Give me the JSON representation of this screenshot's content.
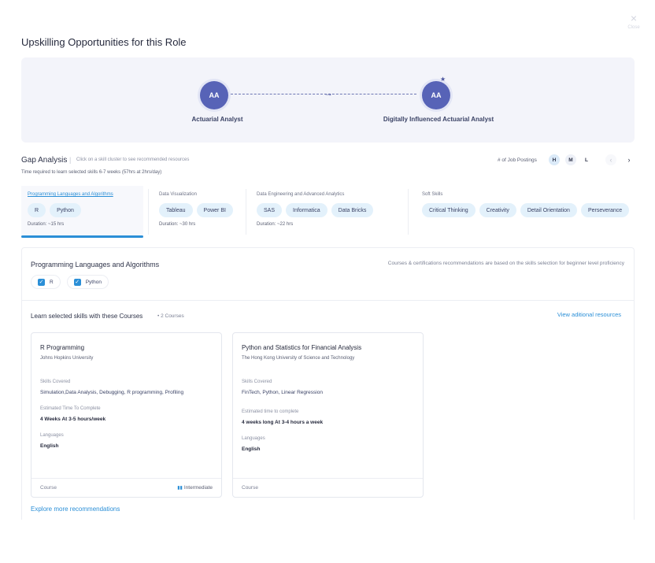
{
  "modal": {
    "title": "Upskilling Opportunities for this Role",
    "close_label": "Close"
  },
  "roles": {
    "from": {
      "initials": "AA",
      "name": "Actuarial Analyst"
    },
    "to": {
      "initials": "AA",
      "name": "Digitally Influenced Actuarial Analyst"
    }
  },
  "gap_analysis": {
    "title": "Gap Analysis",
    "separator": "|",
    "hint": "Click on a skill cluster to see recommended resources",
    "time_required": "Time required to learn selected skills 6-7 weeks (57hrs at 2hrs/day)",
    "job_postings_label": "# of Job Postings",
    "levels": [
      "H",
      "M",
      "L"
    ],
    "prev_icon": "‹",
    "next_icon": "›"
  },
  "clusters": [
    {
      "title": "Programming Languages and Algorithms",
      "skills": [
        "R",
        "Python"
      ],
      "duration": "Duration: ~15 hrs"
    },
    {
      "title": "Data Visualization",
      "skills": [
        "Tableau",
        "Power BI"
      ],
      "duration": "Duration: ~30 hrs"
    },
    {
      "title": "Data Engineering and Advanced Analytics",
      "skills": [
        "SAS",
        "Informatica",
        "Data Bricks"
      ],
      "duration": "Duration: ~22 hrs"
    },
    {
      "title": "Soft Skills",
      "skills": [
        "Critical Thinking",
        "Creativity",
        "Detail Orientation",
        "Perseverance"
      ],
      "duration": ""
    }
  ],
  "details": {
    "title": "Programming Languages and Algorithms",
    "note": "Courses & certifications recommendations are based on the skills selection for beginner level proficiency",
    "checkboxes": [
      "R",
      "Python"
    ],
    "check_glyph": "✓",
    "learn_title": "Learn selected skills with these Courses",
    "course_count": "• 2 Courses",
    "view_link": "View aditional resources",
    "explore_link": "Explore more recommendations"
  },
  "courses": [
    {
      "name": "R Programming",
      "provider": "Johns Hopkins University",
      "skills_label": "Skills Covered",
      "skills": "Simulation,Data Analysis, Debugging, R programming, Profiling",
      "time_label": "Estimated Time To Complete",
      "time": "4 Weeks At 3-5 hours/week",
      "lang_label": "Languages",
      "lang": "English",
      "type": "Course",
      "level": "Intermediate"
    },
    {
      "name": "Python and Statistics for Financial Analysis",
      "provider": "The Hong Kong University of Science and Technology",
      "skills_label": "Skills Covered",
      "skills": "FinTech, Python, Linear Regression",
      "time_label": "Estimated time to complete",
      "time": "4 weeks long At 3-4 hours a week",
      "lang_label": "Languages",
      "lang": "English",
      "type": "Course",
      "level": ""
    }
  ],
  "icons": {
    "close": "close-icon",
    "star": "star-icon",
    "arrow": "arrow-right-icon",
    "level": "level-bars-icon"
  },
  "colors": {
    "accent": "#2b8fd7",
    "role_circle": "#5763b7",
    "chip": "#e3f1fb"
  }
}
